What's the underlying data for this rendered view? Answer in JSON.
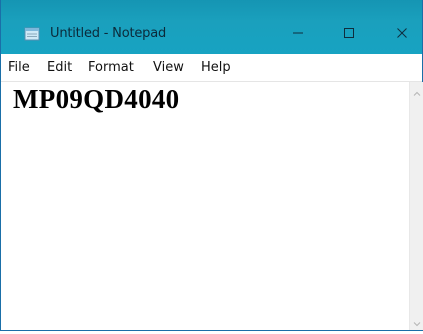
{
  "window": {
    "title": "Untitled - Notepad",
    "icon": "notepad-icon"
  },
  "titlebar_buttons": {
    "minimize_icon": "minimize-icon",
    "maximize_icon": "maximize-icon",
    "close_icon": "close-icon"
  },
  "menu": {
    "items": [
      "File",
      "Edit",
      "Format",
      "View",
      "Help"
    ]
  },
  "editor": {
    "content": "MP09QD4040"
  },
  "colors": {
    "titlebar": "#1aa0bd",
    "text": "#000000"
  }
}
